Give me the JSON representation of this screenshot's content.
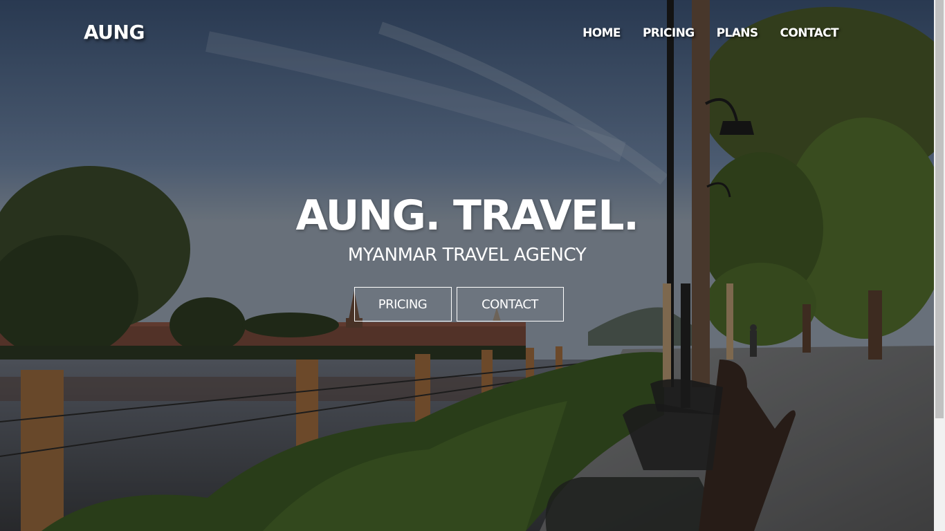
{
  "brand": {
    "logo": "AUNG"
  },
  "nav": {
    "items": [
      {
        "label": "HOME"
      },
      {
        "label": "PRICING"
      },
      {
        "label": "PLANS"
      },
      {
        "label": "CONTACT"
      }
    ]
  },
  "hero": {
    "title": "AUNG. TRAVEL.",
    "subtitle": "MYANMAR TRAVEL AGENCY",
    "buttons": {
      "pricing": "PRICING",
      "contact": "CONTACT"
    },
    "background_image": "riverside-park-bench-photo"
  },
  "colors": {
    "text": "#ffffff",
    "overlay": "#000000"
  }
}
